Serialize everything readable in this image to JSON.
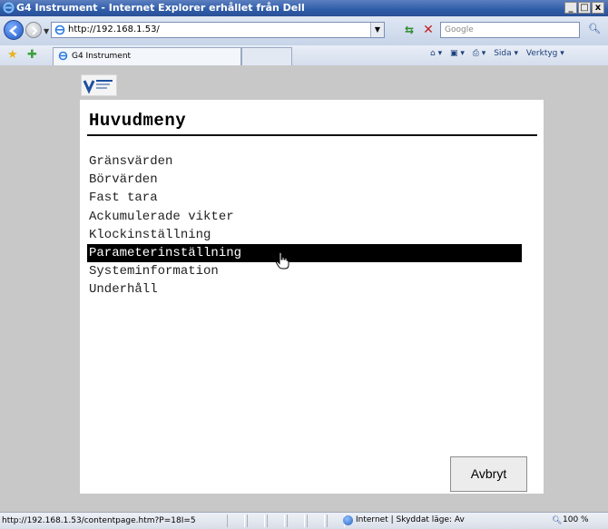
{
  "window": {
    "title": "G4 Instrument - Internet Explorer erhållet från Dell",
    "minimize_label": "_",
    "maximize_label": "□",
    "close_label": "x"
  },
  "address_bar": {
    "url": "http://192.168.1.53/",
    "search_placeholder": "Google"
  },
  "tab": {
    "title": "G4 Instrument"
  },
  "command_bar": {
    "items": [
      "Sida ▾",
      "Verktyg ▾"
    ]
  },
  "page": {
    "logo_text": "VISHAY PRECISION GROUP",
    "heading": "Huvudmeny",
    "menu_items": [
      "Gränsvärden",
      "Börvärden",
      "Fast tara",
      "Ackumulerade vikter",
      "Klockinställning",
      "Parameterinställning",
      "Systeminformation",
      "Underhåll"
    ],
    "selected_index": 5,
    "cancel_label": "Avbryt"
  },
  "status_bar": {
    "url": "http://192.168.1.53/contentpage.htm?P=18I=5",
    "zone": "Internet | Skyddat läge: Av",
    "zoom": "100 %"
  },
  "colors": {
    "selection_bg": "#000000",
    "selection_fg": "#ffffff",
    "page_bg": "#c8c8c8",
    "titlebar": "#2f5ca8"
  }
}
